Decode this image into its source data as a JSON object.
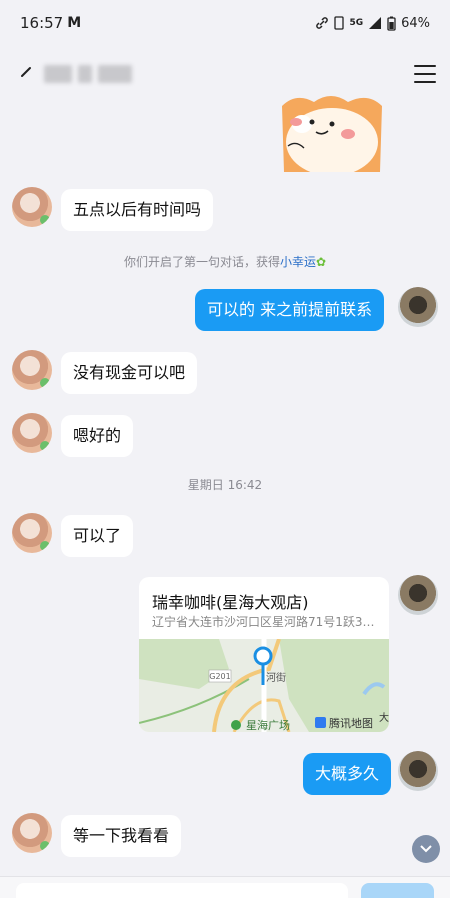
{
  "status_bar": {
    "time": "16:57",
    "mail_glyph": "M",
    "network": "5G",
    "battery": "64%"
  },
  "messages": {
    "m1": "五点以后有时间吗",
    "m2": "可以的 来之前提前联系",
    "m3": "没有现金可以吧",
    "m4": "嗯好的",
    "m5": "可以了",
    "m6": "大概多久",
    "m7": "等一下我看看"
  },
  "system": {
    "first_chat_prefix": "你们开启了第一句对话，获得",
    "first_chat_link": "小幸运",
    "timestamp": "星期日 16:42"
  },
  "location": {
    "title": "瑞幸咖啡(星海大观店)",
    "address": "辽宁省大连市沙河口区星河路71号1跃3层…",
    "map_road": "G201",
    "map_street": "河街",
    "map_place": "星海广场",
    "map_brand": "腾讯地图",
    "map_corner": "大"
  },
  "input": {
    "placeholder": ""
  },
  "colors": {
    "out_bubble": "#1a9bf4",
    "in_bubble": "#ffffff",
    "background": "#f2f2f6"
  }
}
